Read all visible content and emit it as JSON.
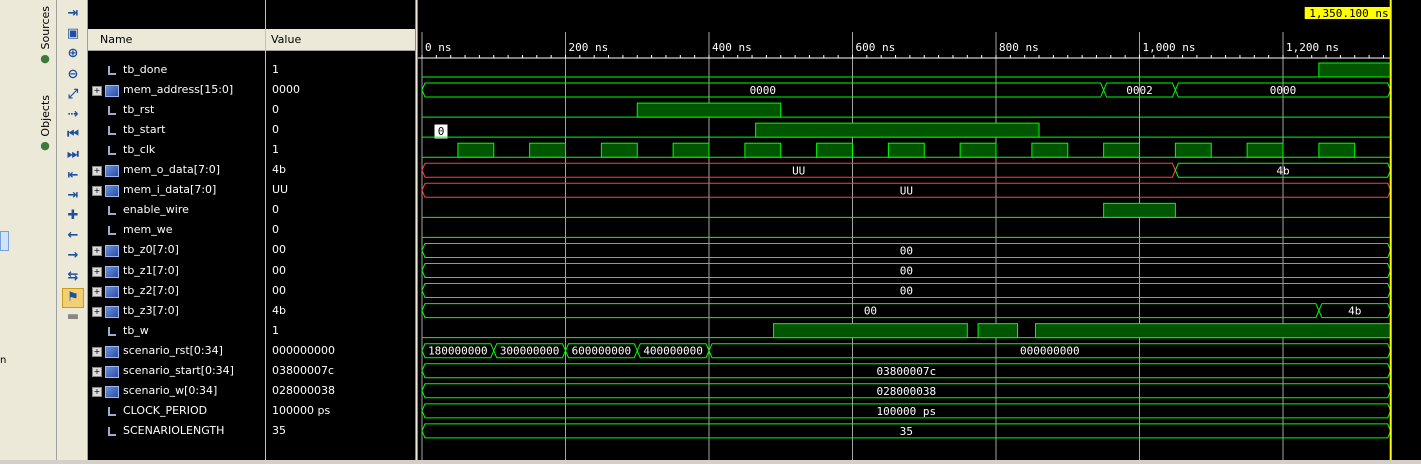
{
  "side_tabs": {
    "sources": "Sources",
    "objects": "Objects"
  },
  "left_strip_text": "n",
  "toolbar_icons": [
    "expand-panel-icon",
    "save-icon",
    "zoom-in-icon",
    "zoom-out-icon",
    "zoom-fit-icon",
    "cursor-to-zero-icon",
    "go-to-time-zero-icon",
    "go-to-last-time-icon",
    "previous-transition-icon",
    "next-transition-icon",
    "add-marker-icon",
    "previous-marker-icon",
    "next-marker-icon",
    "swap-cursors-icon",
    "snap-icon",
    "floating-ruler-icon"
  ],
  "columns": {
    "name": "Name",
    "value": "Value"
  },
  "signals": [
    {
      "name": "tb_done",
      "value": "1",
      "kind": "bit"
    },
    {
      "name": "mem_address[15:0]",
      "value": "0000",
      "kind": "bus"
    },
    {
      "name": "tb_rst",
      "value": "0",
      "kind": "bit"
    },
    {
      "name": "tb_start",
      "value": "0",
      "kind": "bit"
    },
    {
      "name": "tb_clk",
      "value": "1",
      "kind": "bit"
    },
    {
      "name": "mem_o_data[7:0]",
      "value": "4b",
      "kind": "bus"
    },
    {
      "name": "mem_i_data[7:0]",
      "value": "UU",
      "kind": "bus"
    },
    {
      "name": "enable_wire",
      "value": "0",
      "kind": "bit"
    },
    {
      "name": "mem_we",
      "value": "0",
      "kind": "bit"
    },
    {
      "name": "tb_z0[7:0]",
      "value": "00",
      "kind": "bus"
    },
    {
      "name": "tb_z1[7:0]",
      "value": "00",
      "kind": "bus"
    },
    {
      "name": "tb_z2[7:0]",
      "value": "00",
      "kind": "bus"
    },
    {
      "name": "tb_z3[7:0]",
      "value": "4b",
      "kind": "bus"
    },
    {
      "name": "tb_w",
      "value": "1",
      "kind": "bit"
    },
    {
      "name": "scenario_rst[0:34]",
      "value": "000000000",
      "kind": "bus"
    },
    {
      "name": "scenario_start[0:34]",
      "value": "03800007c",
      "kind": "bus"
    },
    {
      "name": "scenario_w[0:34]",
      "value": "028000038",
      "kind": "bus"
    },
    {
      "name": "CLOCK_PERIOD",
      "value": "100000 ps",
      "kind": "param"
    },
    {
      "name": "SCENARIOLENGTH",
      "value": "35",
      "kind": "param"
    }
  ],
  "cursor_label": "1,350.100 ns",
  "marker_label": "0",
  "time_axis": {
    "start_ns": 0,
    "end_ns": 1350.1,
    "tick_labels": [
      "0 ns",
      "200 ns",
      "400 ns",
      "600 ns",
      "800 ns",
      "1,000 ns",
      "1,200 ns"
    ],
    "tick_values_ns": [
      0,
      200,
      400,
      600,
      800,
      1000,
      1200
    ]
  },
  "waveforms": [
    {
      "signal": "tb_done",
      "type": "bit",
      "high_intervals_ns": [
        [
          1250,
          1350.1
        ]
      ]
    },
    {
      "signal": "mem_address[15:0]",
      "type": "bus",
      "segments": [
        {
          "start": 0,
          "end": 950,
          "label": "0000"
        },
        {
          "start": 950,
          "end": 1050,
          "label": "0002"
        },
        {
          "start": 1050,
          "end": 1350.1,
          "label": "0000"
        }
      ]
    },
    {
      "signal": "tb_rst",
      "type": "bit",
      "high_intervals_ns": [
        [
          300,
          500
        ]
      ]
    },
    {
      "signal": "tb_start",
      "type": "bit",
      "high_intervals_ns": [
        [
          465,
          860
        ]
      ]
    },
    {
      "signal": "tb_clk",
      "type": "bit",
      "high_intervals_ns": [
        [
          50,
          100
        ],
        [
          150,
          200
        ],
        [
          250,
          300
        ],
        [
          350,
          400
        ],
        [
          450,
          500
        ],
        [
          550,
          600
        ],
        [
          650,
          700
        ],
        [
          750,
          800
        ],
        [
          850,
          900
        ],
        [
          950,
          1000
        ],
        [
          1050,
          1100
        ],
        [
          1150,
          1200
        ],
        [
          1250,
          1300
        ]
      ]
    },
    {
      "signal": "mem_o_data[7:0]",
      "type": "bus",
      "segments": [
        {
          "start": 0,
          "end": 1050,
          "label": "UU",
          "undefined": true
        },
        {
          "start": 1050,
          "end": 1350.1,
          "label": "4b"
        }
      ]
    },
    {
      "signal": "mem_i_data[7:0]",
      "type": "bus",
      "segments": [
        {
          "start": 0,
          "end": 1350.1,
          "label": "UU",
          "undefined": true
        }
      ]
    },
    {
      "signal": "enable_wire",
      "type": "bit",
      "high_intervals_ns": [
        [
          950,
          1050
        ]
      ]
    },
    {
      "signal": "mem_we",
      "type": "bit",
      "high_intervals_ns": []
    },
    {
      "signal": "tb_z0[7:0]",
      "type": "bus",
      "segments": [
        {
          "start": 0,
          "end": 1350.1,
          "label": "00"
        }
      ]
    },
    {
      "signal": "tb_z1[7:0]",
      "type": "bus",
      "segments": [
        {
          "start": 0,
          "end": 1350.1,
          "label": "00"
        }
      ]
    },
    {
      "signal": "tb_z2[7:0]",
      "type": "bus",
      "segments": [
        {
          "start": 0,
          "end": 1350.1,
          "label": "00"
        }
      ]
    },
    {
      "signal": "tb_z3[7:0]",
      "type": "bus",
      "segments": [
        {
          "start": 0,
          "end": 1250,
          "label": "00"
        },
        {
          "start": 1250,
          "end": 1350.1,
          "label": "4b"
        }
      ]
    },
    {
      "signal": "tb_w",
      "type": "bit",
      "high_intervals_ns": [
        [
          490,
          760
        ],
        [
          775,
          830
        ],
        [
          855,
          1350.1
        ]
      ]
    },
    {
      "signal": "scenario_rst[0:34]",
      "type": "bus",
      "segments": [
        {
          "start": 0,
          "end": 100,
          "label": "180000000"
        },
        {
          "start": 100,
          "end": 200,
          "label": "300000000"
        },
        {
          "start": 200,
          "end": 300,
          "label": "600000000"
        },
        {
          "start": 300,
          "end": 400,
          "label": "400000000"
        },
        {
          "start": 400,
          "end": 1350.1,
          "label": "000000000"
        }
      ]
    },
    {
      "signal": "scenario_start[0:34]",
      "type": "bus",
      "segments": [
        {
          "start": 0,
          "end": 1350.1,
          "label": "03800007c"
        }
      ]
    },
    {
      "signal": "scenario_w[0:34]",
      "type": "bus",
      "segments": [
        {
          "start": 0,
          "end": 1350.1,
          "label": "028000038"
        }
      ]
    },
    {
      "signal": "CLOCK_PERIOD",
      "type": "bus",
      "segments": [
        {
          "start": 0,
          "end": 1350.1,
          "label": "100000 ps"
        }
      ]
    },
    {
      "signal": "SCENARIOLENGTH",
      "type": "bus",
      "segments": [
        {
          "start": 0,
          "end": 1350.1,
          "label": "35"
        }
      ]
    }
  ],
  "colors": {
    "wave": "#00ff00",
    "fill": "#005500",
    "undefined": "#ff4040",
    "cursor": "#ffff00",
    "grid": "#c0c0c0",
    "background": "#000000"
  }
}
